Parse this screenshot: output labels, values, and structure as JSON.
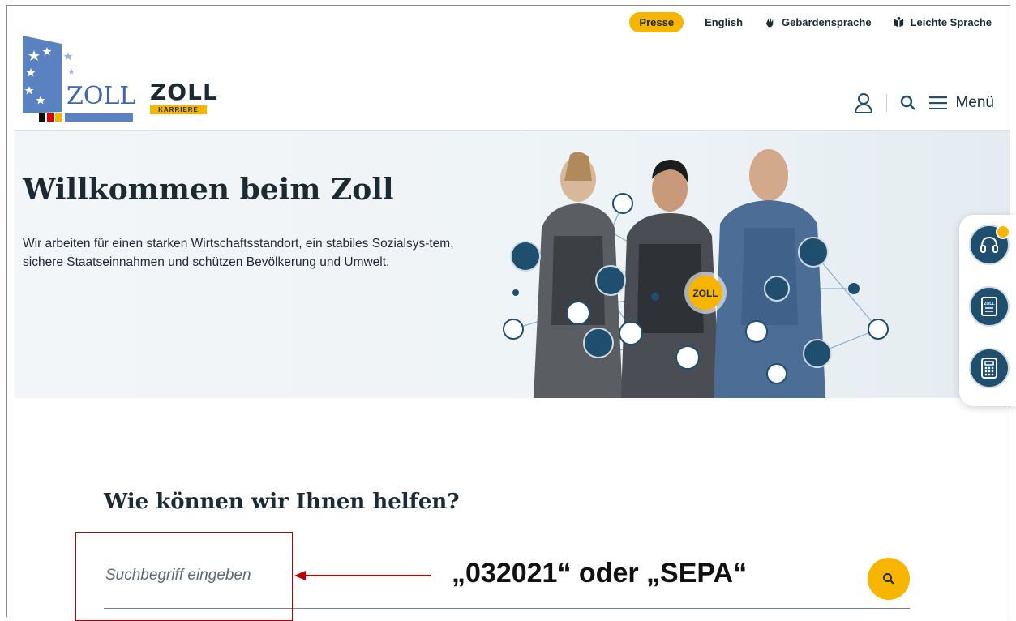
{
  "topbar": {
    "press_label": "Presse",
    "english_label": "English",
    "sign_language_label": "Gebärdensprache",
    "easy_language_label": "Leichte Sprache"
  },
  "header": {
    "logo_text": "ZOLL",
    "karriere_logo_word": "ZOLL",
    "karriere_logo_tag": "KARRIERE",
    "menu_label": "Menü"
  },
  "hero": {
    "title": "Willkommen beim Zoll",
    "text": "Wir arbeiten für einen starken Wirtschaftsstandort, ein stabiles Sozialsys-tem, sichere Staatseinnahmen und schützen Bevölkerung und Umwelt.",
    "badge_label": "ZOLL"
  },
  "search": {
    "heading": "Wie können wir Ihnen helfen?",
    "placeholder": "Suchbegriff eingeben"
  },
  "annotation": {
    "text": "„032021“ oder „SEPA“"
  },
  "colors": {
    "accent_yellow": "#f7b500",
    "dark_blue": "#1f4e6e",
    "annotation_red": "#c00000"
  }
}
